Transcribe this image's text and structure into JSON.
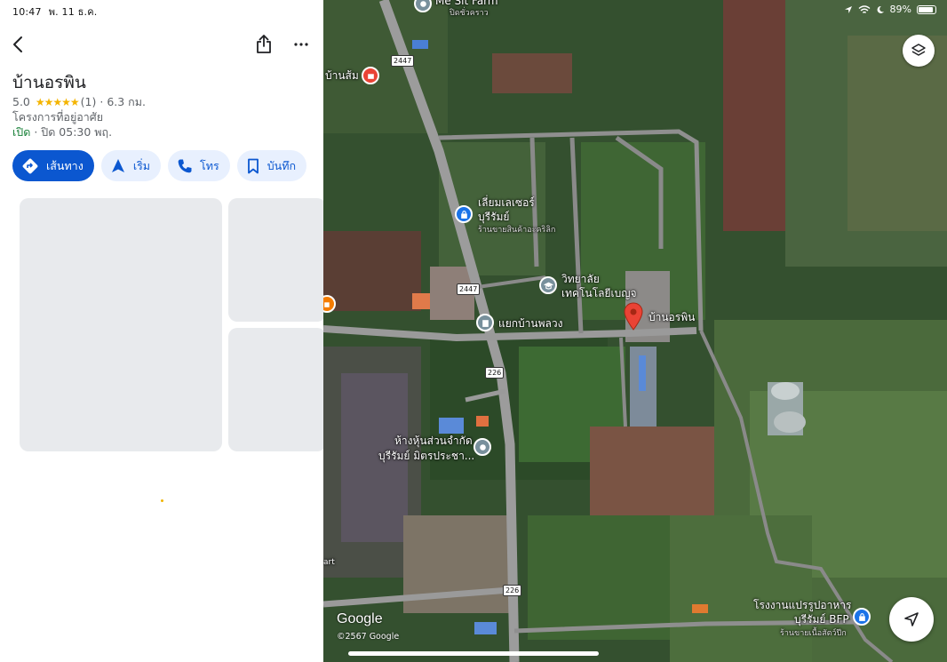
{
  "status": {
    "time": "10:47",
    "date": "พ. 11 ธ.ค.",
    "battery": "89%"
  },
  "place": {
    "title": "บ้านอรพิน",
    "rating": "5.0",
    "stars": "★★★★★",
    "reviews": "(1)",
    "distance": "· 6.3 กม.",
    "category": "โครงการที่อยู่อาศัย",
    "open_status": "เปิด",
    "close_time": "· ปิด 05:30 พฤ."
  },
  "actions": [
    {
      "label": "เส้นทาง",
      "icon": "directions-icon"
    },
    {
      "label": "เริ่ม",
      "icon": "navigation-arrow-icon"
    },
    {
      "label": "โทร",
      "icon": "phone-icon"
    },
    {
      "label": "บันทึก",
      "icon": "bookmark-icon"
    }
  ],
  "map": {
    "labels": {
      "top_farm": "Me Sit Farm",
      "top_farm_sub": "ปิดชั่วคราว",
      "ban_som": "บ้านส้ม",
      "laser_1": "เลี่ยมเลเซอร์",
      "laser_2": "บุรีรัมย์",
      "laser_sub": "ร้านขายสินค้าอะคริลิก",
      "college_1": "วิทยาลัย",
      "college_2": "เทคโนโลยีเบญจ",
      "junction": "แยกบ้านพลวง",
      "pin_label": "บ้านอรพิน",
      "shop_1": "ห้างหุ้นส่วนจำกัด",
      "shop_2": "บุรีรัมย์ มิตรประชา...",
      "art": "art",
      "factory_1": "โรงงานแปรรูปอาหาร",
      "factory_2": "บุรีรัมย์ BFP",
      "factory_sub": "ร้านขายเนื้อสัตว์ปีก"
    },
    "road_shields": [
      "2447",
      "2447",
      "226",
      "226"
    ],
    "brand": "Google",
    "copyright": "©2567 Google"
  },
  "colors": {
    "accent": "#0b57d0",
    "chip_bg": "#e8f0fe",
    "open_green": "#188038",
    "pin_red": "#ea4335",
    "star": "#f4b400"
  }
}
